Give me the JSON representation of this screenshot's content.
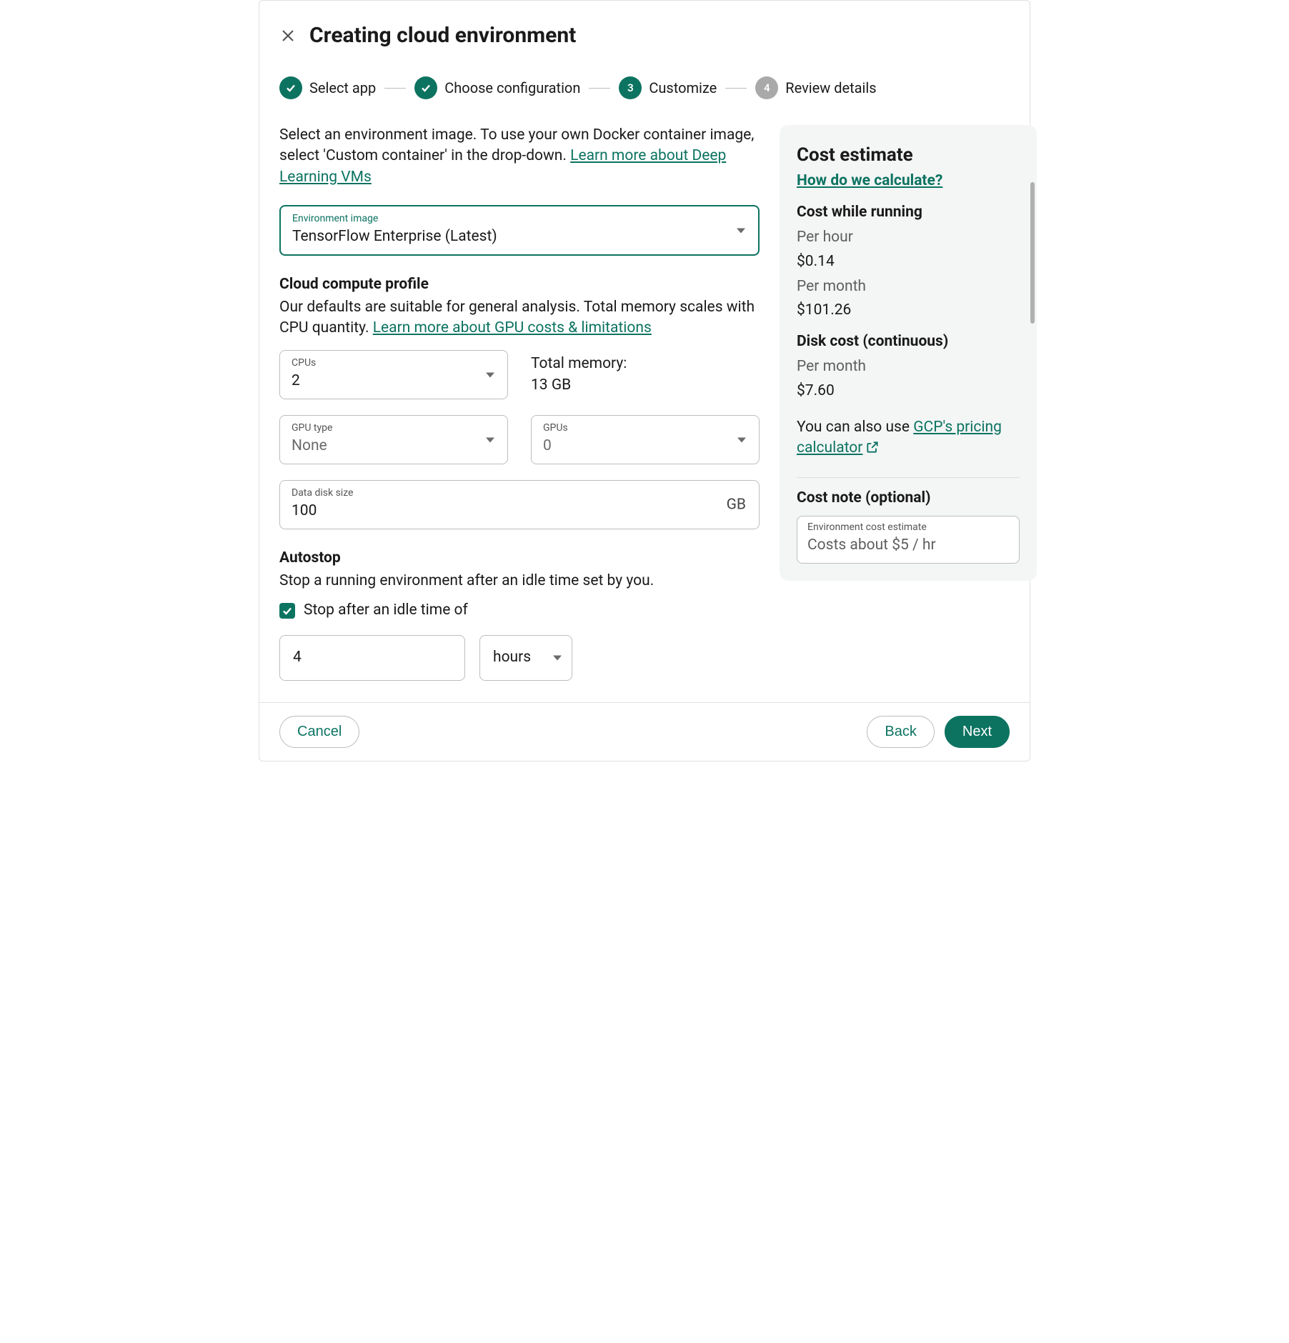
{
  "header": {
    "title": "Creating cloud environment"
  },
  "stepper": {
    "steps": [
      {
        "label": "Select app",
        "state": "done"
      },
      {
        "label": "Choose configuration",
        "state": "done"
      },
      {
        "label": "Customize",
        "state": "current",
        "num": "3"
      },
      {
        "label": "Review details",
        "state": "pending",
        "num": "4"
      }
    ]
  },
  "intro": {
    "text": "Select an environment image. To use your own Docker container image, select 'Custom container' in the drop-down. ",
    "link": "Learn more about Deep Learning VMs"
  },
  "env_image": {
    "label": "Environment image",
    "value": "TensorFlow Enterprise (Latest)"
  },
  "profile": {
    "title": "Cloud compute profile",
    "desc_pre": "Our defaults are suitable for general analysis. Total memory scales with CPU quantity. ",
    "link": "Learn more about GPU costs & limitations",
    "cpus_label": "CPUs",
    "cpus_value": "2",
    "total_memory_label": "Total memory:",
    "total_memory_value": "13 GB",
    "gpu_type_label": "GPU type",
    "gpu_type_value": "None",
    "gpus_label": "GPUs",
    "gpus_value": "0",
    "disk_label": "Data disk size",
    "disk_value": "100",
    "disk_unit": "GB"
  },
  "autostop": {
    "title": "Autostop",
    "desc": "Stop a running environment after an idle time set by you.",
    "checkbox_label": "Stop after an idle time of",
    "value": "4",
    "unit": "hours"
  },
  "cost": {
    "title": "Cost estimate",
    "how_link": "How do we calculate?",
    "running_title": "Cost while running",
    "per_hour_label": "Per hour",
    "per_hour_value": "$0.14",
    "per_month_label": "Per month",
    "per_month_value": "$101.26",
    "disk_title": "Disk cost (continuous)",
    "disk_per_month_label": "Per month",
    "disk_per_month_value": "$7.60",
    "also_text": "You can also use ",
    "calc_link": "GCP's pricing calculator",
    "note_title": "Cost note (optional)",
    "note_label": "Environment cost estimate",
    "note_placeholder": "Costs about $5 / hr"
  },
  "footer": {
    "cancel": "Cancel",
    "back": "Back",
    "next": "Next"
  }
}
